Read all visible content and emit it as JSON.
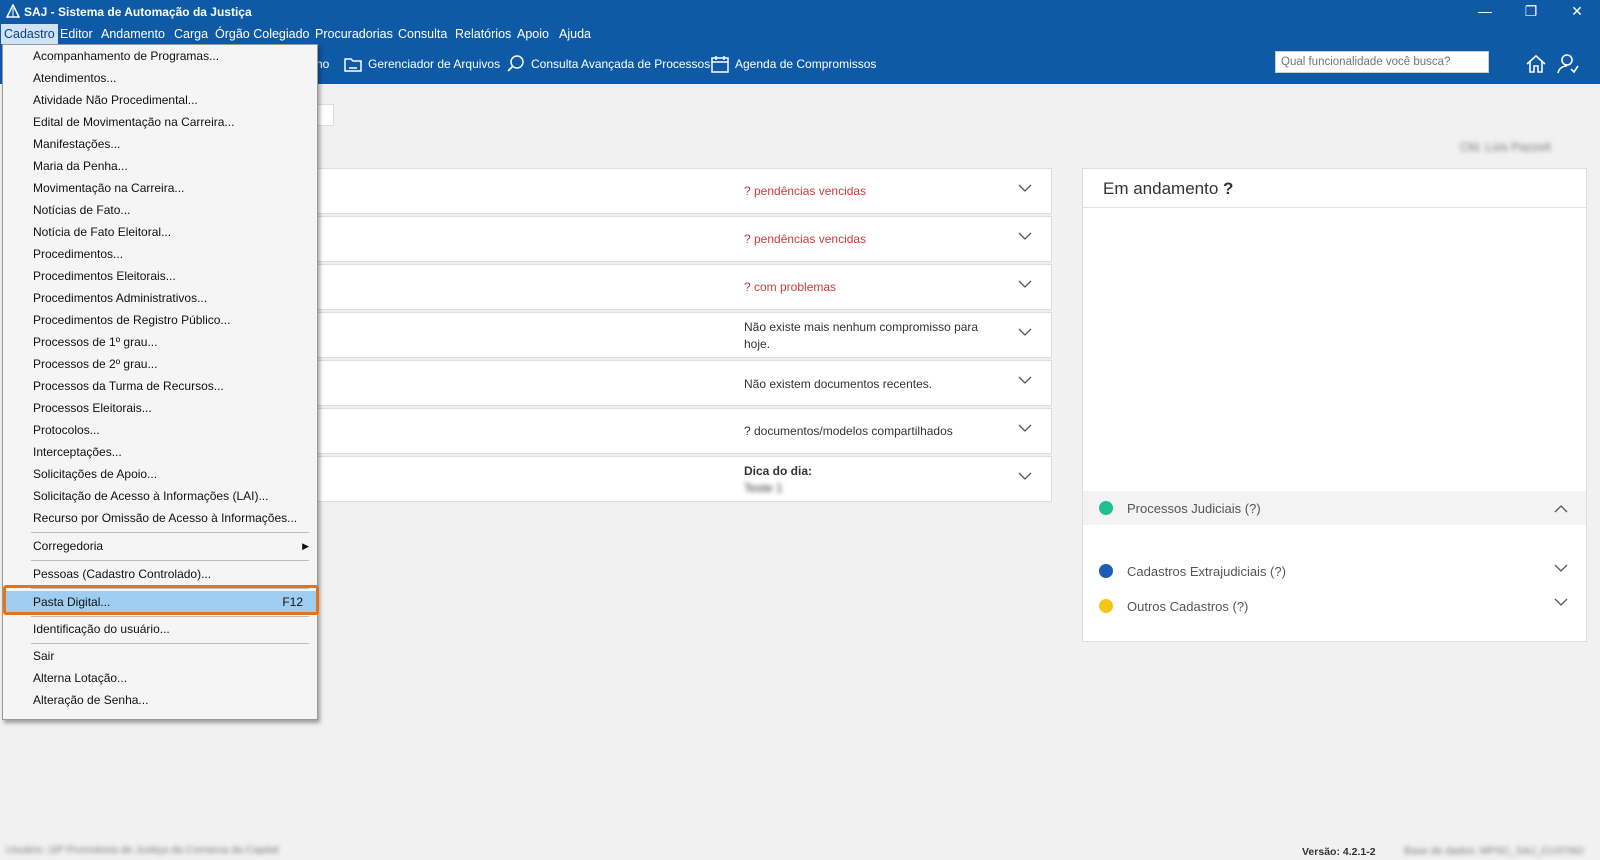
{
  "window": {
    "title": "SAJ - Sistema de Automação da Justiça",
    "minimize_glyph": "—",
    "restore_glyph": "❐",
    "close_glyph": "✕"
  },
  "menubar": [
    {
      "label": "Cadastro",
      "active": true
    },
    {
      "label": "Editor"
    },
    {
      "label": "Andamento"
    },
    {
      "label": "Carga"
    },
    {
      "label": "Órgão Colegiado"
    },
    {
      "label": "Procuradorias"
    },
    {
      "label": "Consulta"
    },
    {
      "label": "Relatórios"
    },
    {
      "label": "Apoio"
    },
    {
      "label": "Ajuda"
    }
  ],
  "toolbar": {
    "partial_label": "ho",
    "file_manager": "Gerenciador de Arquivos",
    "advanced_search": "Consulta Avançada de Processos",
    "agenda": "Agenda de Compromissos",
    "search_placeholder": "Qual funcionalidade você busca?",
    "home_icon": "home-icon",
    "user_icon": "user-switch-icon"
  },
  "header": {
    "user_name": "Cfd. Lúís Pazzelt"
  },
  "dropdown": {
    "items": [
      "Acompanhamento de Programas...",
      "Atendimentos...",
      "Atividade Não Procedimental...",
      "Edital de Movimentação na Carreira...",
      "Manifestações...",
      "Maria da Penha...",
      "Movimentação na Carreira...",
      "Notícias de Fato...",
      "Notícia de Fato Eleitoral...",
      "Procedimentos...",
      "Procedimentos Eleitorais...",
      "Procedimentos Administrativos...",
      "Procedimentos de Registro Público...",
      "Processos de 1º grau...",
      "Processos de 2º grau...",
      "Processos da Turma de Recursos...",
      "Processos Eleitorais...",
      "Protocolos...",
      "Interceptações...",
      "Solicitações de Apoio...",
      "Solicitação de Acesso à Informações (LAI)...",
      "Recurso por Omissão de Acesso à Informações..."
    ],
    "corregedoria": "Corregedoria",
    "pessoas": "Pessoas (Cadastro Controlado)...",
    "pasta_digital": "Pasta Digital...",
    "pasta_digital_shortcut": "F12",
    "identificacao": "Identificação do usuário...",
    "sair": "Sair",
    "alterna": "Alterna Lotação...",
    "alteracao": "Alteração de Senha..."
  },
  "pendencies": [
    {
      "text": "? pendências vencidas",
      "red": true
    },
    {
      "text": "? pendências vencidas",
      "red": true
    },
    {
      "text": "? com problemas",
      "red": true
    },
    {
      "text": "Não existe mais nenhum compromisso para hoje.",
      "red": false
    },
    {
      "text": "Não existem documentos recentes.",
      "red": false
    },
    {
      "text": "? documentos/modelos compartilhados",
      "red": false
    }
  ],
  "tip": {
    "label": "Dica do dia:",
    "value": "Teste 1"
  },
  "in_progress": {
    "title": "Em andamento",
    "title_mark": "?",
    "groups": [
      {
        "label": "Processos Judiciais (?)",
        "color": "#1fbf8f"
      },
      {
        "label": "Cadastros Extrajudiciais (?)",
        "color": "#1a5fb4"
      },
      {
        "label": "Outros Cadastros (?)",
        "color": "#f5c518"
      }
    ]
  },
  "status": {
    "left": "Usuário: 18ª Promotoria de Justiça da Comarca da Capital",
    "version": "Versão: 4.2.1-2",
    "database": "Base de dados: MPSC_SAJ_CUSTAD"
  },
  "colors": {
    "brand_blue": "#0e5aa7",
    "highlight_orange": "#e3741b",
    "selected_item": "#9fcdf2",
    "alert_red": "#d03a3a"
  }
}
